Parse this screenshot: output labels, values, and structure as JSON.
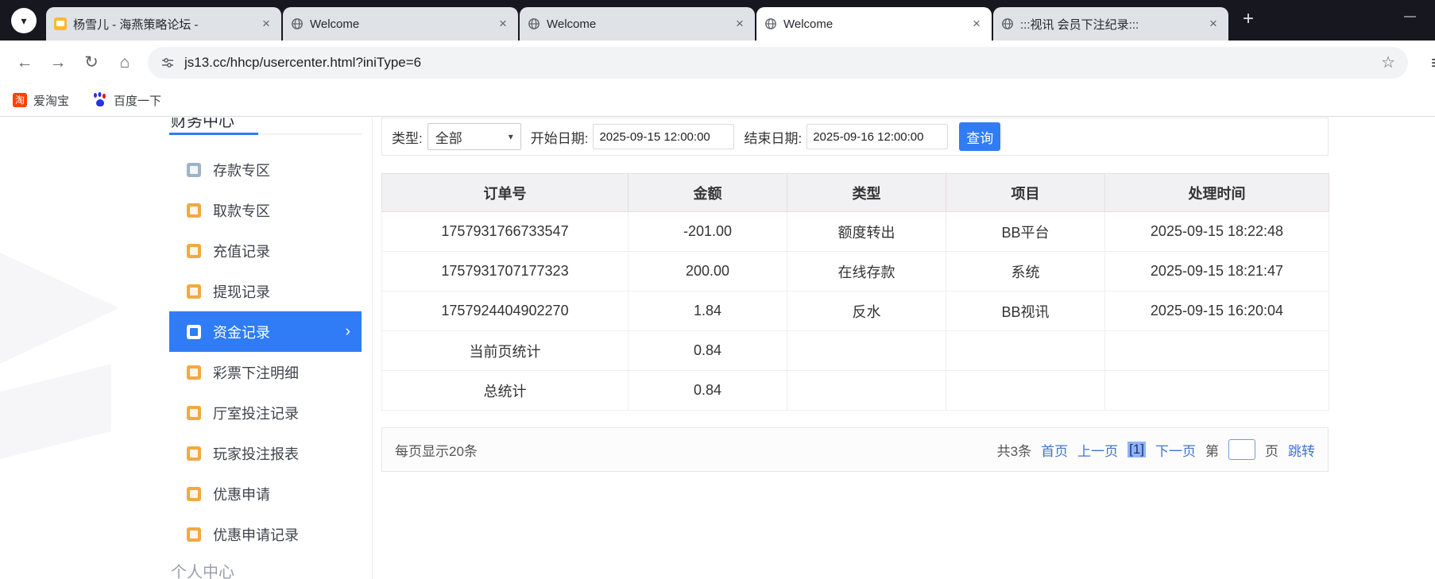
{
  "colors": {
    "accent": "#2f7cf6",
    "link": "#3f74d6",
    "tabstrip_bg": "#17171f"
  },
  "icons": {
    "tab_search": "▾",
    "close": "×",
    "new_tab": "+",
    "minimize": "—",
    "back": "←",
    "forward": "→",
    "reload": "↻",
    "home": "⌂",
    "star": "☆",
    "overflow": "≡",
    "select_arrow": "▾",
    "chevron_right": "›",
    "taobao": "淘"
  },
  "browser": {
    "tabs": [
      {
        "label": "杨雪儿 - 海燕策略论坛 -",
        "active": false
      },
      {
        "label": "Welcome",
        "active": false
      },
      {
        "label": "Welcome",
        "active": false
      },
      {
        "label": "Welcome",
        "active": true
      },
      {
        "label": ":::视讯 会员下注纪录:::",
        "active": false
      }
    ],
    "url": "js13.cc/hhcp/usercenter.html?iniType=6",
    "bookmarks": [
      {
        "label": "爱淘宝"
      },
      {
        "label": "百度一下"
      }
    ]
  },
  "sidebar": {
    "section_top": "财务中心",
    "section_bottom": "个人中心",
    "items": [
      {
        "label": "存款专区",
        "active": false
      },
      {
        "label": "取款专区",
        "active": false
      },
      {
        "label": "充值记录",
        "active": false
      },
      {
        "label": "提现记录",
        "active": false
      },
      {
        "label": "资金记录",
        "active": true
      },
      {
        "label": "彩票下注明细",
        "active": false
      },
      {
        "label": "厅室投注记录",
        "active": false
      },
      {
        "label": "玩家投注报表",
        "active": false
      },
      {
        "label": "优惠申请",
        "active": false
      },
      {
        "label": "优惠申请记录",
        "active": false
      }
    ]
  },
  "filters": {
    "type_label": "类型:",
    "type_value": "全部",
    "start_label": "开始日期:",
    "start_value": "2025-09-15 12:00:00",
    "end_label": "结束日期:",
    "end_value": "2025-09-16 12:00:00",
    "search_button": "查询"
  },
  "table": {
    "headers": [
      "订单号",
      "金额",
      "类型",
      "项目",
      "处理时间"
    ],
    "rows": [
      [
        "1757931766733547",
        "-201.00",
        "额度转出",
        "BB平台",
        "2025-09-15 18:22:48"
      ],
      [
        "1757931707177323",
        "200.00",
        "在线存款",
        "系统",
        "2025-09-15 18:21:47"
      ],
      [
        "1757924404902270",
        "1.84",
        "反水",
        "BB视讯",
        "2025-09-15 16:20:04"
      ],
      [
        "当前页统计",
        "0.84",
        "",
        "",
        ""
      ],
      [
        "总统计",
        "0.84",
        "",
        "",
        ""
      ]
    ]
  },
  "pagination": {
    "page_size_label": "每页显示20条",
    "total": "共3条",
    "first": "首页",
    "prev": "上一页",
    "current": "[1]",
    "next": "下一页",
    "jump_prefix": "第",
    "jump_value": "",
    "jump_suffix": "页",
    "jump_action": "跳转"
  }
}
